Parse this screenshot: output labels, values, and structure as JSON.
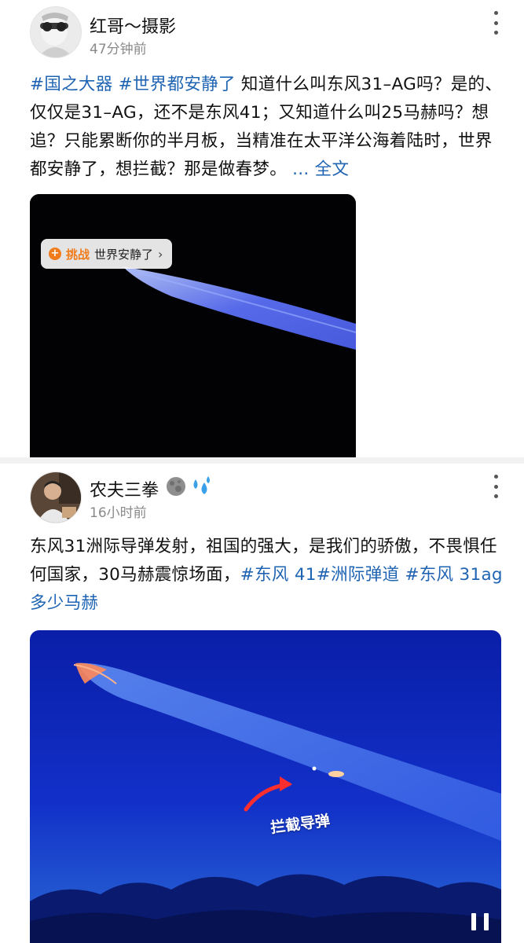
{
  "posts": [
    {
      "username": "红哥～摄影",
      "time": "47分钟前",
      "text": {
        "tag1": "#国之大器",
        "tag2": "#世界都安静了",
        "body": " 知道什么叫东风31–AG吗？是的、仅仅是31–AG，还不是东风41；又知道什么叫25马赫吗？想追？只能累断你的半月板，当精准在太平洋公海着陆时，世界都安静了，想拦截？那是做春梦。 ",
        "more_link": "... 全文"
      },
      "media": {
        "challenge_badge": "挑战",
        "challenge_title": "世界安静了",
        "challenge_arrow": "›"
      }
    },
    {
      "username": "农夫三拳",
      "time": "16小时前",
      "text": {
        "body": "东风31洲际导弹发射，祖国的强大，是我们的骄傲，不畏惧任何国家，30马赫震惊场面，",
        "tag1": "#东风 41",
        "tag2": "#洲际弹道",
        "tag3": "#东风 31ag 多少马赫"
      },
      "media": {
        "overlay_label": "拦截导弹"
      }
    }
  ],
  "icons": [
    "more-vertical-icon",
    "challenge-plus-icon",
    "pause-icon",
    "moon-emoji-icon",
    "sweat-drops-emoji-icon"
  ],
  "colors": {
    "link": "#1f64b3",
    "challenge": "#f07c1b",
    "feed_background": "#f2f2f2"
  }
}
